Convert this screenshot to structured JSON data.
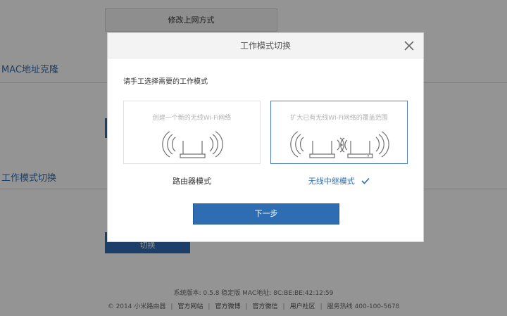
{
  "background": {
    "top_button_label": "修改上网方式",
    "mac_section_title": "MAC地址克隆",
    "mode_section_title": "工作模式切换",
    "switch_button_label": "切换"
  },
  "modal": {
    "title": "工作模式切换",
    "prompt": "请手工选择需要的工作模式",
    "options": [
      {
        "description": "创建一个新的无线Wi-Fi网络",
        "label": "路由器模式",
        "selected": false,
        "icon": "router-wifi-icon"
      },
      {
        "description": "扩大已有无线Wi-Fi网络的覆盖范围",
        "label": "无线中继模式",
        "selected": true,
        "icon": "repeater-wifi-icon"
      }
    ],
    "next_button_label": "下一步",
    "close_icon": "close-icon"
  },
  "footer": {
    "version_line": "系统版本: 0.5.8 稳定版   MAC地址: 8C:BE:BE:42:12:59",
    "copyright": "© 2014 小米路由器",
    "links": [
      "官方网站",
      "官方微博",
      "官方微信",
      "用户社区"
    ],
    "hotline": "服务热线 400-100-5678"
  },
  "colors": {
    "accent": "#2f6db3",
    "overlay": "rgba(0,0,0,0.42)",
    "selected_border": "#4a7fb9"
  }
}
